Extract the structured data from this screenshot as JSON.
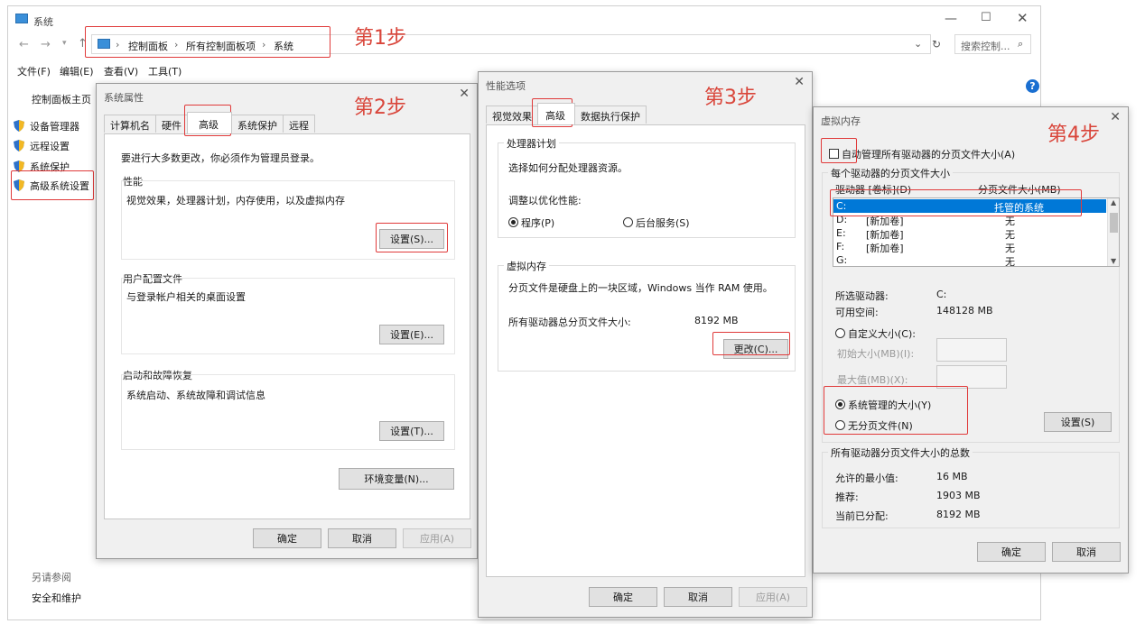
{
  "main_window": {
    "title": "系统",
    "address": [
      "控制面板",
      "所有控制面板项",
      "系统"
    ],
    "search_placeholder": "搜索控制...",
    "menu": [
      "文件(F)",
      "编辑(E)",
      "查看(V)",
      "工具(T)"
    ],
    "sidebar_home": "控制面板主页",
    "sidebar_items": [
      "设备管理器",
      "远程设置",
      "系统保护",
      "高级系统设置"
    ],
    "see_also": "另请参阅",
    "security": "安全和维护"
  },
  "steps": [
    "第1步",
    "第2步",
    "第3步",
    "第4步"
  ],
  "system_props": {
    "title": "系统属性",
    "tabs": [
      "计算机名",
      "硬件",
      "高级",
      "系统保护",
      "远程"
    ],
    "admin_note": "要进行大多数更改，你必须作为管理员登录。",
    "perf_label": "性能",
    "perf_desc": "视觉效果，处理器计划，内存使用，以及虚拟内存",
    "perf_btn": "设置(S)...",
    "profile_label": "用户配置文件",
    "profile_desc": "与登录帐户相关的桌面设置",
    "profile_btn": "设置(E)...",
    "startup_label": "启动和故障恢复",
    "startup_desc": "系统启动、系统故障和调试信息",
    "startup_btn": "设置(T)...",
    "env_btn": "环境变量(N)...",
    "ok": "确定",
    "cancel": "取消",
    "apply": "应用(A)"
  },
  "perf_options": {
    "title": "性能选项",
    "tabs": [
      "视觉效果",
      "高级",
      "数据执行保护"
    ],
    "sched_label": "处理器计划",
    "sched_desc": "选择如何分配处理器资源。",
    "optimize": "调整以优化性能:",
    "opt_program": "程序(P)",
    "opt_bg": "后台服务(S)",
    "vm_label": "虚拟内存",
    "vm_desc": "分页文件是硬盘上的一块区域，Windows 当作 RAM 使用。",
    "vm_total_label": "所有驱动器总分页文件大小:",
    "vm_total_value": "8192 MB",
    "change_btn": "更改(C)...",
    "ok": "确定",
    "cancel": "取消",
    "apply": "应用(A)"
  },
  "virtual_memory": {
    "title": "虚拟内存",
    "auto_manage": "自动管理所有驱动器的分页文件大小(A)",
    "per_drive": "每个驱动器的分页文件大小",
    "col_drive": "驱动器 [卷标](D)",
    "col_size": "分页文件大小(MB)",
    "drives": [
      {
        "drive": "C:",
        "label": "",
        "size": "托管的系统"
      },
      {
        "drive": "D:",
        "label": "[新加卷]",
        "size": "无"
      },
      {
        "drive": "E:",
        "label": "[新加卷]",
        "size": "无"
      },
      {
        "drive": "F:",
        "label": "[新加卷]",
        "size": "无"
      },
      {
        "drive": "G:",
        "label": "",
        "size": "无"
      }
    ],
    "selected_label": "所选驱动器:",
    "selected_value": "C:",
    "free_label": "可用空间:",
    "free_value": "148128 MB",
    "custom": "自定义大小(C):",
    "initial": "初始大小(MB)(I):",
    "max": "最大值(MB)(X):",
    "sys_managed": "系统管理的大小(Y)",
    "no_paging": "无分页文件(N)",
    "set_btn": "设置(S)",
    "total_label": "所有驱动器分页文件大小的总数",
    "min_label": "允许的最小值:",
    "min_value": "16 MB",
    "rec_label": "推荐:",
    "rec_value": "1903 MB",
    "cur_label": "当前已分配:",
    "cur_value": "8192 MB",
    "ok": "确定",
    "cancel": "取消"
  },
  "colors": {
    "accent": "#0078d7",
    "highlight": "#e03a3a",
    "selection": "#0078d7"
  }
}
